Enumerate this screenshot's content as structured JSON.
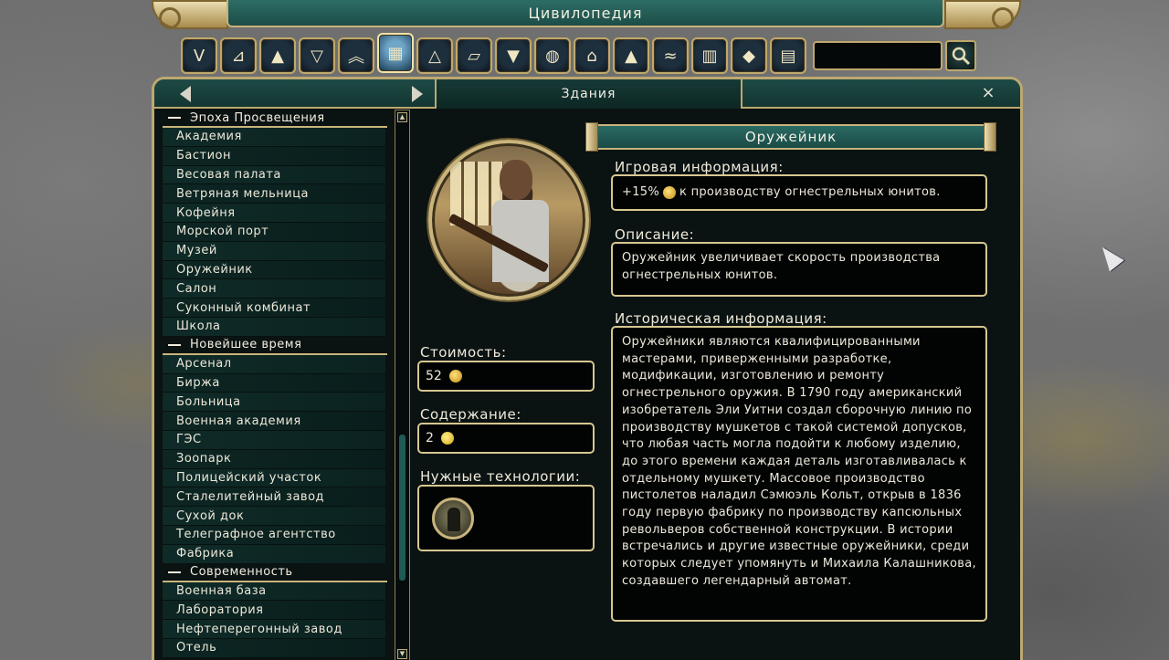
{
  "app": {
    "title": "Цивилопедия"
  },
  "search": {
    "value": "",
    "placeholder": ""
  },
  "categories": [
    {
      "icon": "v-emblem-icon"
    },
    {
      "icon": "compass-icon"
    },
    {
      "icon": "mountain-icon"
    },
    {
      "icon": "shield-icon"
    },
    {
      "icon": "chevrons-icon"
    },
    {
      "icon": "building-icon",
      "active": true
    },
    {
      "icon": "pyramid-icon"
    },
    {
      "icon": "scroll-map-icon"
    },
    {
      "icon": "triangle-emblem-icon"
    },
    {
      "icon": "globe-leaves-icon"
    },
    {
      "icon": "capitol-icon"
    },
    {
      "icon": "city-icon"
    },
    {
      "icon": "handshake-icon"
    },
    {
      "icon": "factory-icon"
    },
    {
      "icon": "drop-icon"
    },
    {
      "icon": "document-icon"
    }
  ],
  "nav": {
    "title": "Здания",
    "close": "×"
  },
  "list": {
    "groups": [
      {
        "era": "Эпоха Просвещения",
        "items": [
          "Академия",
          "Бастион",
          "Весовая палата",
          "Ветряная мельница",
          "Кофейня",
          "Морской порт",
          "Музей",
          "Оружейник",
          "Салон",
          "Суконный комбинат",
          "Школа"
        ]
      },
      {
        "era": "Новейшее время",
        "items": [
          "Арсенал",
          "Биржа",
          "Больница",
          "Военная академия",
          "ГЭС",
          "Зоопарк",
          "Полицейский участок",
          "Сталелитейный завод",
          "Сухой док",
          "Телеграфное агентство",
          "Фабрика"
        ]
      },
      {
        "era": "Современность",
        "items": [
          "Военная база",
          "Лаборатория",
          "Нефтеперегонный завод",
          "Отель"
        ]
      }
    ]
  },
  "detail": {
    "name": "Оружейник",
    "cost_label": "Стоимость:",
    "cost_value": "52",
    "upkeep_label": "Содержание:",
    "upkeep_value": "2",
    "tech_label": "Нужные технологии:",
    "game_info_label": "Игровая информация:",
    "game_info_prefix": "+15%",
    "game_info_suffix": "к производству огнестрельных юнитов.",
    "description_label": "Описание:",
    "description": "Оружейник увеличивает скорость производства огнестрельных юнитов.",
    "history_label": "Историческая информация:",
    "history": "Оружейники являются квалифицированными мастерами, приверженными разработке, модификации, изготовлению и ремонту огнестрельного оружия. В 1790 году американский изобретатель Эли Уитни создал сборочную линию по производству мушкетов с такой системой допусков, что любая часть могла подойти к любому изделию, до этого времени каждая деталь изготавливалась к отдельному мушкету. Массовое производство пистолетов наладил Сэмюэль Кольт, открыв в 1836 году первую фабрику по производству капсюльных револьверов собственной конструкции. В истории встречались и другие известные оружейники, среди которых следует упомянуть и Михаила Калашникова, создавшего легендарный автомат."
  }
}
